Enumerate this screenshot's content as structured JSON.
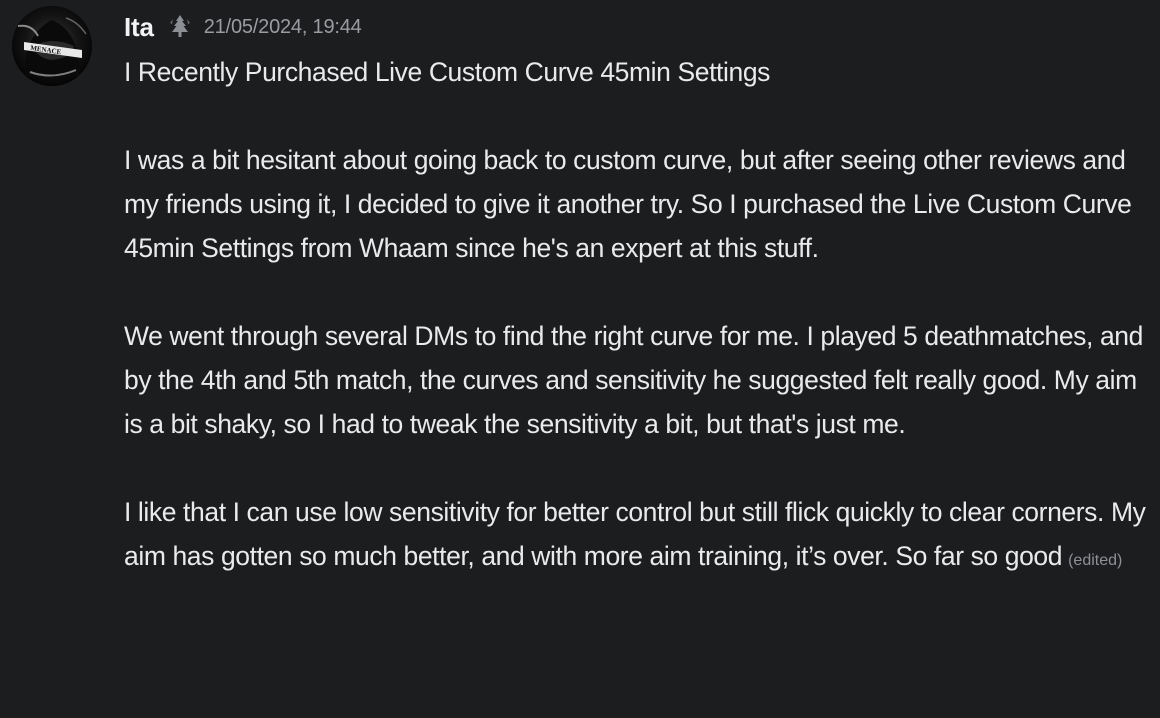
{
  "message": {
    "author": {
      "username": "Ita",
      "avatar_icon": "masked-figure-avatar",
      "avatar_text": "MENACE",
      "role_icon": "pine-tree-icon"
    },
    "timestamp": "21/05/2024, 19:44",
    "paragraphs": [
      "I Recently Purchased Live Custom Curve 45min Settings",
      "I was a bit hesitant about going back to custom curve, but after seeing other reviews and my friends using it, I decided to give it another try. So I purchased the Live Custom Curve 45min Settings from Whaam since he's an expert at this stuff.",
      "We went through several DMs to find the right curve for me. I played 5 deathmatches, and by the 4th and 5th match, the curves and sensitivity he suggested felt really good. My aim is a bit shaky, so I had to tweak the sensitivity a bit, but that's just me.",
      "I like that I can use low sensitivity for better control but still flick quickly to clear corners. My aim has gotten so much better, and with more aim training, it’s over. So far so good"
    ],
    "edited_label": "(edited)"
  },
  "colors": {
    "background": "#1b1d1f",
    "text": "#e9eaec",
    "username": "#f2f3f5",
    "muted": "#9a9ca1"
  }
}
